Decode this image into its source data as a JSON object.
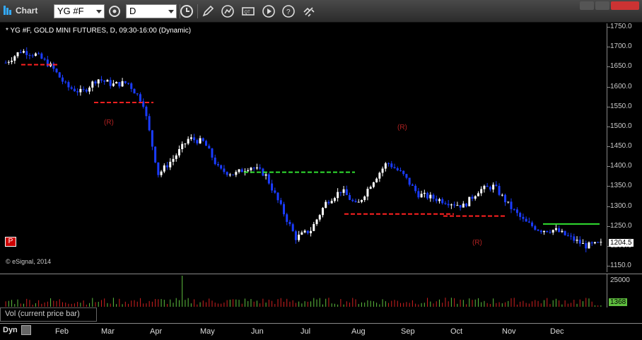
{
  "window": {
    "title": "Chart",
    "symbol_value": "YG #F",
    "interval_value": "D"
  },
  "legend": {
    "text": "* YG #F, GOLD MINI FUTURES, D, 09:30-16:00 (Dynamic)"
  },
  "copyright": "© eSignal, 2014",
  "price_axis": {
    "ticks": [
      "1750.0",
      "1700.0",
      "1650.0",
      "1600.0",
      "1550.0",
      "1500.0",
      "1450.0",
      "1400.0",
      "1350.0",
      "1300.0",
      "1250.0",
      "1200.0",
      "1150.0"
    ],
    "last_price": "1204.5"
  },
  "volume": {
    "label": "Vol (current price bar)",
    "tick": "25000",
    "last": "1368"
  },
  "months": [
    "Feb",
    "Mar",
    "Apr",
    "May",
    "Jun",
    "Jul",
    "Aug",
    "Sep",
    "Oct",
    "Nov",
    "Dec"
  ],
  "bottom": {
    "dyn_label": "Dyn"
  },
  "p_button": "P",
  "annotations": [
    {
      "text": "(R)",
      "color": "#b22222"
    },
    {
      "text": "(R)",
      "color": "#b22222"
    },
    {
      "text": "(R)",
      "color": "#b22222"
    }
  ],
  "colors": {
    "up": "#ffffff",
    "down": "#1a3cff",
    "support": "#ff2020",
    "resistance": "#30e030",
    "setup_yellow": "#e8e800",
    "setup_green": "#3a9a3a",
    "countdown_red": "#ff2020"
  },
  "chart_data": {
    "type": "candlestick",
    "title": "",
    "symbol": "YG #F",
    "xlabel": "",
    "ylabel": "",
    "x_categories": [
      "Feb",
      "Mar",
      "Apr",
      "May",
      "Jun",
      "Jul",
      "Aug",
      "Sep",
      "Oct",
      "Nov",
      "Dec"
    ],
    "ylim": [
      1150,
      1750
    ],
    "close_path": [
      [
        "Jan",
        1660
      ],
      [
        "Jan",
        1690
      ],
      [
        "Feb",
        1680
      ],
      [
        "Feb",
        1650
      ],
      [
        "Feb",
        1600
      ],
      [
        "Mar",
        1585
      ],
      [
        "Mar",
        1620
      ],
      [
        "Mar",
        1605
      ],
      [
        "Apr",
        1610
      ],
      [
        "Apr",
        1560
      ],
      [
        "Apr",
        1380
      ],
      [
        "Apr",
        1420
      ],
      [
        "May",
        1470
      ],
      [
        "May",
        1460
      ],
      [
        "May",
        1390
      ],
      [
        "Jun",
        1380
      ],
      [
        "Jun",
        1400
      ],
      [
        "Jun",
        1380
      ],
      [
        "Jul",
        1300
      ],
      [
        "Jul",
        1220
      ],
      [
        "Jul",
        1240
      ],
      [
        "Jul",
        1310
      ],
      [
        "Aug",
        1340
      ],
      [
        "Aug",
        1300
      ],
      [
        "Aug",
        1360
      ],
      [
        "Sep",
        1410
      ],
      [
        "Sep",
        1380
      ],
      [
        "Sep",
        1330
      ],
      [
        "Oct",
        1320
      ],
      [
        "Oct",
        1310
      ],
      [
        "Oct",
        1300
      ],
      [
        "Oct",
        1340
      ],
      [
        "Nov",
        1350
      ],
      [
        "Nov",
        1300
      ],
      [
        "Nov",
        1260
      ],
      [
        "Dec",
        1240
      ],
      [
        "Dec",
        1240
      ],
      [
        "Dec",
        1220
      ],
      [
        "Dec",
        1200
      ],
      [
        "Dec",
        1204.5
      ]
    ],
    "levels": [
      {
        "kind": "support",
        "price": 1655,
        "from": "Jan",
        "to": "Feb"
      },
      {
        "kind": "support",
        "price": 1560,
        "from": "Mar",
        "to": "Apr"
      },
      {
        "kind": "resistance",
        "price": 1385,
        "from": "Jun",
        "to": "Aug"
      },
      {
        "kind": "support",
        "price": 1280,
        "from": "Aug",
        "to": "Oct"
      },
      {
        "kind": "support",
        "price": 1275,
        "from": "Oct",
        "to": "Nov"
      },
      {
        "kind": "resistance",
        "price": 1255,
        "from": "Dec",
        "to": "Dec"
      }
    ],
    "last_price": 1204.5,
    "volume_last": 1368,
    "volume_tick": 25000,
    "grid": false,
    "legend": "top-left"
  }
}
